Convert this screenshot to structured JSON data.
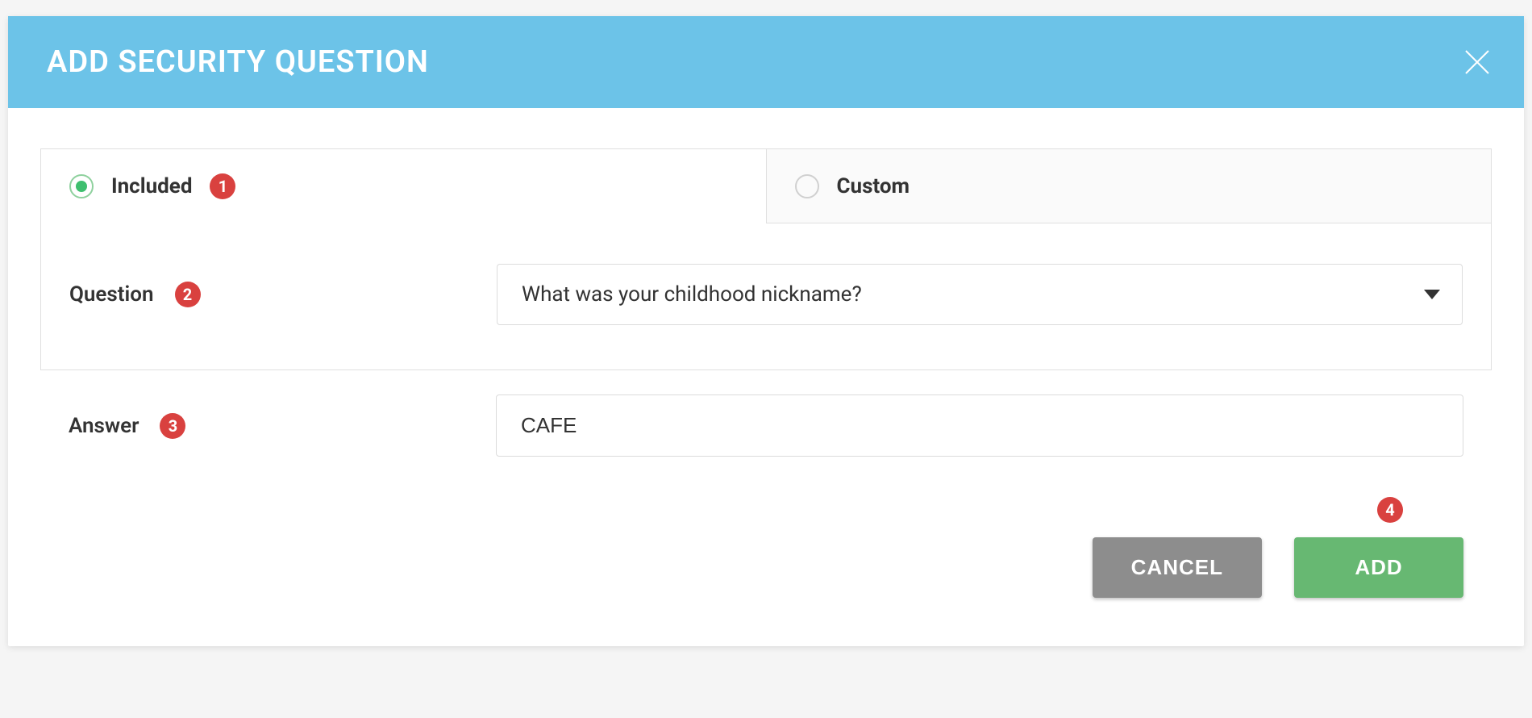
{
  "modal": {
    "title": "ADD SECURITY QUESTION"
  },
  "tabs": {
    "included": {
      "label": "Included",
      "selected": true
    },
    "custom": {
      "label": "Custom",
      "selected": false
    }
  },
  "fields": {
    "question": {
      "label": "Question",
      "value": "What was your childhood nickname?"
    },
    "answer": {
      "label": "Answer",
      "value": "CAFE"
    }
  },
  "buttons": {
    "cancel": "CANCEL",
    "add": "ADD"
  },
  "badges": {
    "b1": "1",
    "b2": "2",
    "b3": "3",
    "b4": "4"
  }
}
